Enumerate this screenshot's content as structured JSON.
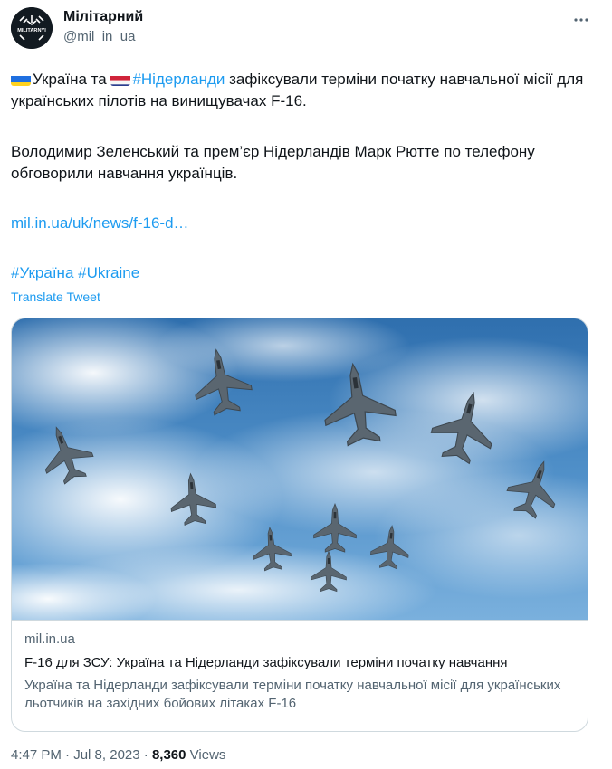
{
  "author": {
    "name": "Мілітарний",
    "handle": "@mil_in_ua",
    "avatar_text": "MILITARNYI"
  },
  "tweet": {
    "line1_part1": "Україна та ",
    "hashtag_netherlands": "#Нідерланди",
    "line1_part2": " зафіксували терміни початку навчальної місії для українських пілотів на винищувачах F-16.",
    "paragraph2": "Володимир Зеленський та прем’єр Нідерландів Марк Рютте по телефону обговорили навчання українців.",
    "link": "mil.in.ua/uk/news/f-16-d…",
    "hashtag_ukraina": "#Україна",
    "hashtag_ukraine": "#Ukraine",
    "translate": "Translate Tweet"
  },
  "card": {
    "domain": "mil.in.ua",
    "title": "F-16 для ЗСУ: Україна та Нідерланди зафіксували терміни початку навчання",
    "description": "Україна та Нідерланди зафіксували терміни початку навчальної місії для українських льотчиків на західних бойових літаках F-16"
  },
  "meta": {
    "time": "4:47 PM",
    "date": "Jul 8, 2023",
    "separator": "·",
    "views_count": "8,360",
    "views_label": "Views"
  },
  "colors": {
    "link": "#1d9bf0",
    "secondary_text": "#536471",
    "border": "#cfd9de"
  },
  "icons": {
    "more": "more-horizontal-icon",
    "flag_ukraine": "flag-ukraine-icon",
    "flag_netherlands": "flag-netherlands-icon"
  }
}
